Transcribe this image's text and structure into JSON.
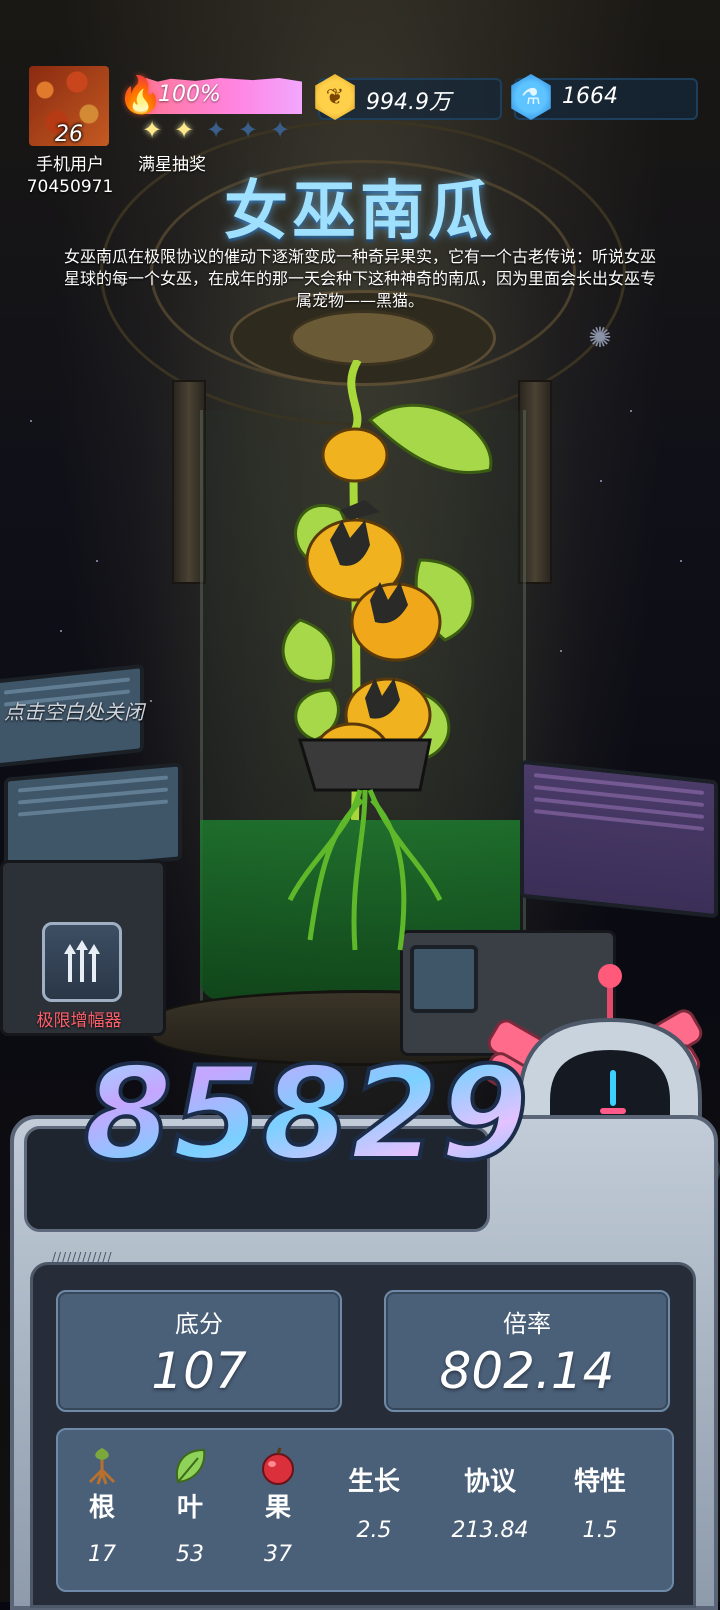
{
  "player": {
    "level": "26",
    "name": "手机用户",
    "id": "70450971",
    "avatar_icon": "avatar"
  },
  "heat": {
    "percent_text": "100%",
    "fill": 1.0,
    "icon": "flame-icon"
  },
  "star_lottery": {
    "stars_filled": 2,
    "stars_total": 5,
    "label": "满星抽奖"
  },
  "currencies": {
    "coins": {
      "value": "994.9万",
      "icon": "coin-icon"
    },
    "gems": {
      "value": "1664",
      "icon": "gem-icon"
    }
  },
  "plant": {
    "title": "女巫南瓜",
    "description": "女巫南瓜在极限协议的催动下逐渐变成一种奇异果实，它有一个古老传说：听说女巫星球的每一个女巫，在成年的那一天会种下这种神奇的南瓜，因为里面会长出女巫专属宠物——黑猫。"
  },
  "hint": {
    "close": "点击空白处关闭"
  },
  "amplifier": {
    "label": "极限增幅器",
    "icon": "triple-arrow-up-icon"
  },
  "score": {
    "total": "85829",
    "base_label": "底分",
    "base_value": "107",
    "multiplier_label": "倍率",
    "multiplier_value": "802.14"
  },
  "attributes": [
    {
      "name": "根",
      "value": "17",
      "icon": "root-icon"
    },
    {
      "name": "叶",
      "value": "53",
      "icon": "leaf-icon"
    },
    {
      "name": "果",
      "value": "37",
      "icon": "apple-icon"
    },
    {
      "name": "生长",
      "value": "2.5"
    },
    {
      "name": "协议",
      "value": "213.84"
    },
    {
      "name": "特性",
      "value": "1.5"
    }
  ],
  "colors": {
    "title": "#9fe0ff",
    "amp_label": "#ff5f6a",
    "panel": "#4a5f78",
    "accent_pink": "#ff7be0"
  }
}
